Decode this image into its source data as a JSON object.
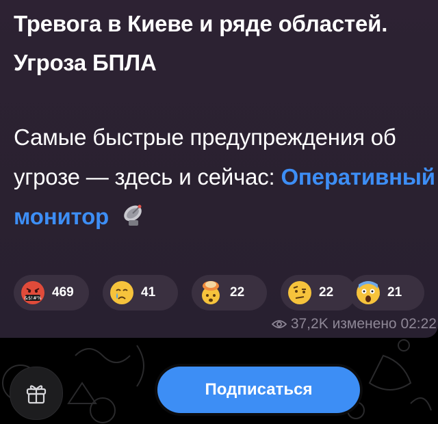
{
  "message": {
    "title": "Тревога в Киеве и ряде областей. Угроза БПЛА",
    "body_text": "Самые быстрые предупреждения об угрозе — здесь и сейчас: ",
    "link_text": "Оперативный монитор",
    "reactions": [
      {
        "emoji": "angry-cursing-face",
        "count": "469"
      },
      {
        "emoji": "crying-face",
        "count": "41"
      },
      {
        "emoji": "exploding-head",
        "count": "22"
      },
      {
        "emoji": "face-with-raised-eyebrow",
        "count": "22"
      },
      {
        "emoji": "screaming-face",
        "count": "21"
      }
    ],
    "views": "37,2K",
    "edited_label": "изменено",
    "time": "02:22"
  },
  "bottom_bar": {
    "gift_icon": "gift-icon",
    "subscribe_label": "Подписаться"
  },
  "colors": {
    "accent": "#3d8ef5",
    "bubble": "#2d2233",
    "reaction_bg": "#3a3040"
  }
}
